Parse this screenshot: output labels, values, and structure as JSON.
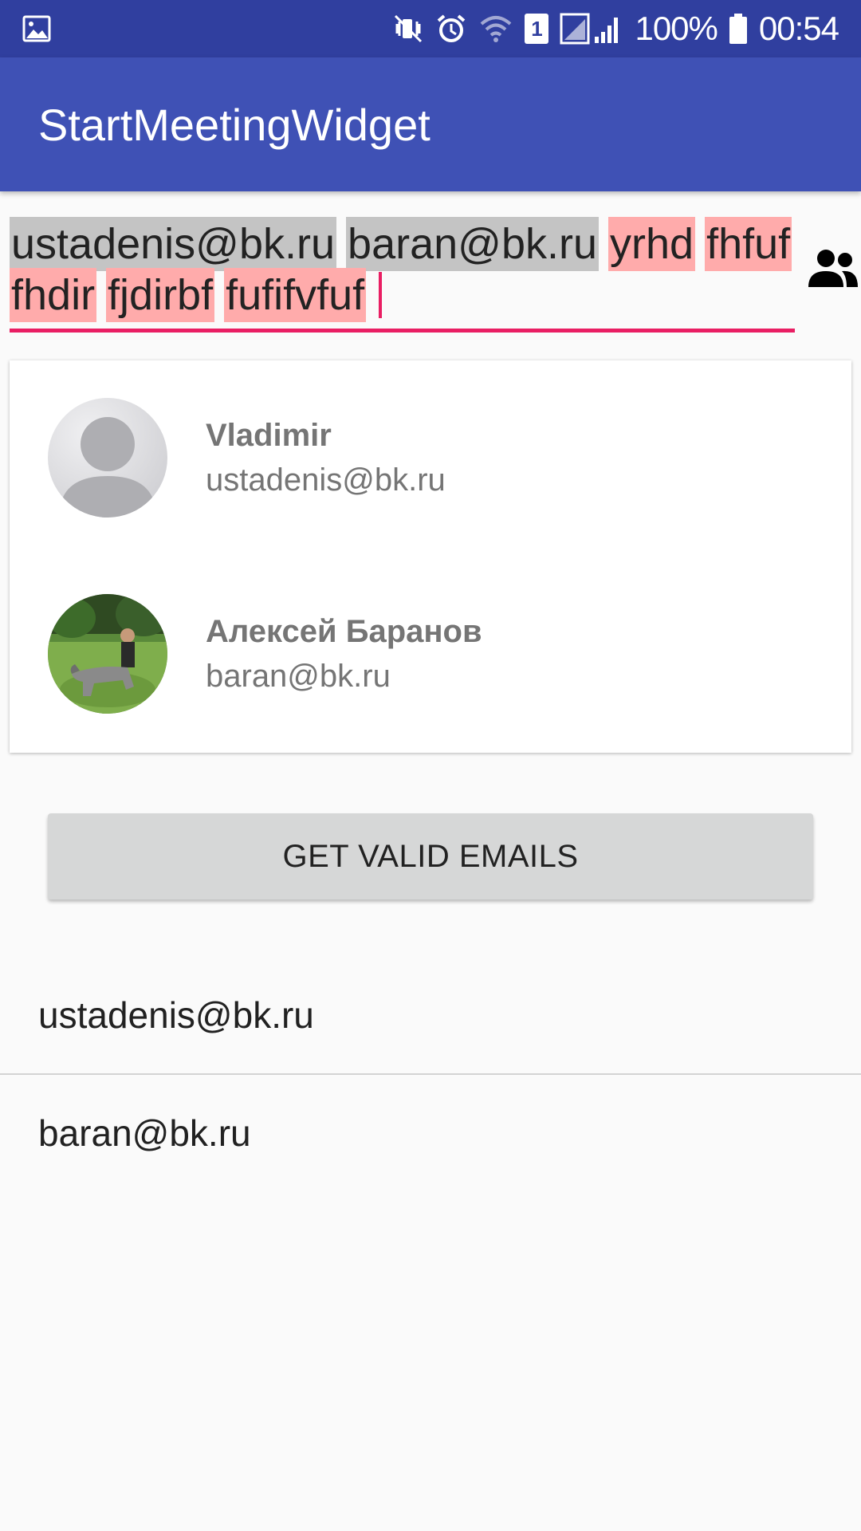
{
  "status_bar": {
    "battery": "100%",
    "time": "00:54",
    "sim_number": "1",
    "icons": [
      "gallery-icon",
      "mute-vibrate-icon",
      "alarm-icon",
      "wifi-icon",
      "sim-icon",
      "signal-icon",
      "battery-icon"
    ]
  },
  "app_bar": {
    "title": "StartMeetingWidget",
    "color": "#3f51b5",
    "status_color": "#303f9f"
  },
  "chips": {
    "line1": [
      {
        "text": "ustadenis@bk.ru",
        "state": "valid"
      },
      {
        "text": "baran@bk.ru",
        "state": "valid"
      },
      {
        "text": "yrhd",
        "state": "invalid"
      },
      {
        "text": "fhfuf",
        "state": "invalid"
      }
    ],
    "line2": [
      {
        "text": "fhdir",
        "state": "invalid"
      },
      {
        "text": "fjdirbf",
        "state": "invalid"
      },
      {
        "text": "fufifvfuf",
        "state": "invalid"
      }
    ],
    "valid_color": "#c4c4c4",
    "invalid_color": "#ffabab",
    "accent_color": "#e91e63",
    "contacts_icon": "contacts-icon"
  },
  "suggestions": [
    {
      "name": "Vladimir",
      "email": "ustadenis@bk.ru",
      "avatar": "default-avatar"
    },
    {
      "name": "Алексей Баранов",
      "email": "baran@bk.ru",
      "avatar": "photo-avatar"
    }
  ],
  "button": {
    "label": "GET VALID EMAILS"
  },
  "results": [
    "ustadenis@bk.ru",
    "baran@bk.ru"
  ]
}
